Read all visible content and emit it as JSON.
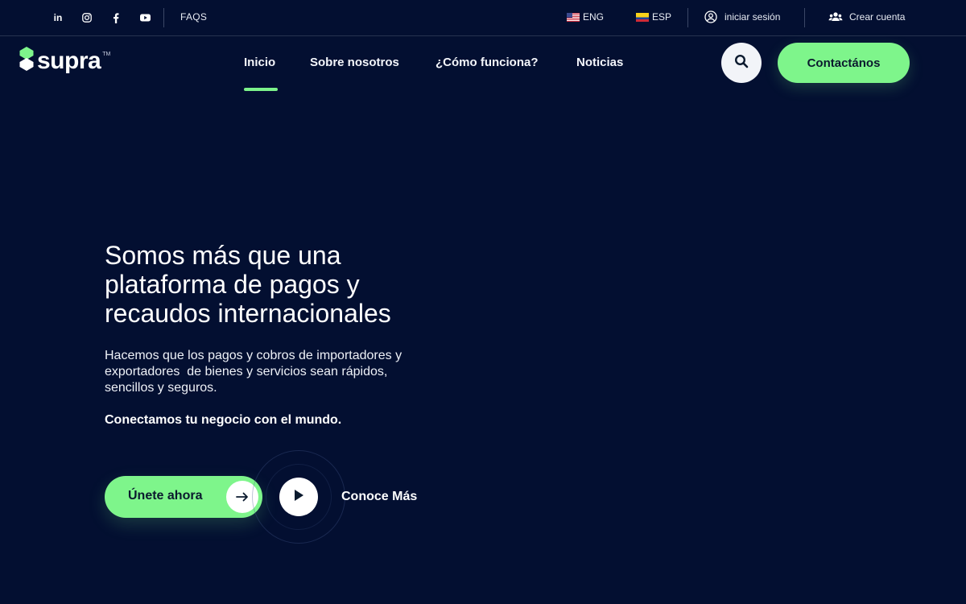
{
  "topbar": {
    "social": [
      {
        "icon": "linkedin-icon",
        "label": "in"
      },
      {
        "icon": "instagram-icon"
      },
      {
        "icon": "facebook-icon"
      },
      {
        "icon": "youtube-icon"
      }
    ],
    "faqs": "FAQS",
    "languages": [
      {
        "code": "ENG",
        "flag": "us-flag-icon"
      },
      {
        "code": "ESP",
        "flag": "colombia-flag-icon"
      }
    ],
    "login": "iniciar sesión",
    "signup": "Crear cuenta"
  },
  "brand": {
    "name": "supra",
    "tm": "TM",
    "accent": "#7ef58b"
  },
  "nav": {
    "items": [
      "Inicio",
      "Sobre nosotros",
      "¿Cómo funciona?",
      "Noticias"
    ],
    "active": "Inicio",
    "contact": "Contactános"
  },
  "hero": {
    "title_lines": [
      "Somos más que una",
      "plataforma de pagos y",
      "recaudos internacionales"
    ],
    "desc_lines": [
      "Hacemos que los pagos y cobros de importadores y",
      "exportadores  de bienes y servicios sean rápidos,",
      "sencillos y seguros."
    ],
    "tagline": "Conectamos tu negocio con el mundo.",
    "join": "Únete ahora",
    "more": "Conoce Más"
  },
  "colors": {
    "background": "#030f31",
    "accent": "#7ef58b",
    "text": "#ffffff"
  }
}
